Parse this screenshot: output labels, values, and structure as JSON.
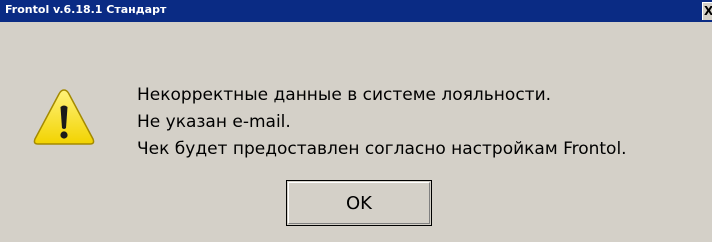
{
  "window": {
    "title": "Frontol v.6.18.1 Стандарт",
    "close_label": "X"
  },
  "dialog": {
    "icon": "warning-icon",
    "lines": [
      "Некорректные данные в системе лояльности.",
      "Не указан e-mail.",
      "Чек будет предоставлен согласно настройкам Frontol."
    ],
    "ok_label": "OK"
  },
  "colors": {
    "titlebar": "#0a2b84",
    "background": "#d4d0c8",
    "warning_yellow": "#f5e12a"
  }
}
